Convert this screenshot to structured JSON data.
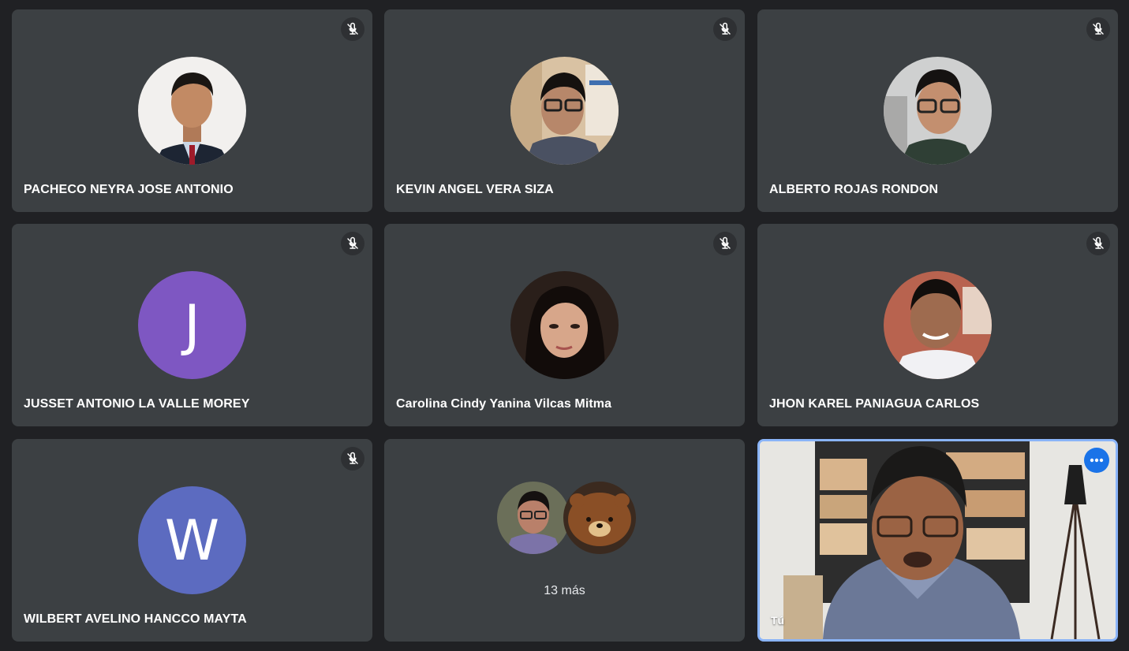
{
  "colors": {
    "background": "#202124",
    "tile": "#3c4043",
    "mute_badge": "#2e3033",
    "self_border": "#8ab4f8",
    "options_button": "#1a73e8"
  },
  "participants": [
    {
      "name": "PACHECO NEYRA JOSE ANTONIO",
      "muted": true,
      "avatar": "photo"
    },
    {
      "name": "KEVIN ANGEL VERA SIZA",
      "muted": true,
      "avatar": "photo"
    },
    {
      "name": "ALBERTO ROJAS RONDON",
      "muted": true,
      "avatar": "photo"
    },
    {
      "name": "JUSSET ANTONIO LA VALLE MOREY",
      "muted": true,
      "avatar": "letter",
      "letter": "J",
      "color": "#7e57c2"
    },
    {
      "name": "Carolina Cindy Yanina Vilcas Mitma",
      "muted": true,
      "avatar": "photo"
    },
    {
      "name": "JHON KAREL PANIAGUA CARLOS",
      "muted": true,
      "avatar": "photo"
    },
    {
      "name": "WILBERT AVELINO HANCCO MAYTA",
      "muted": true,
      "avatar": "letter",
      "letter": "W",
      "color": "#5c6bc0"
    }
  ],
  "more": {
    "label": "13 más"
  },
  "self": {
    "label": "Tú",
    "options_icon": "more-horiz-icon"
  }
}
